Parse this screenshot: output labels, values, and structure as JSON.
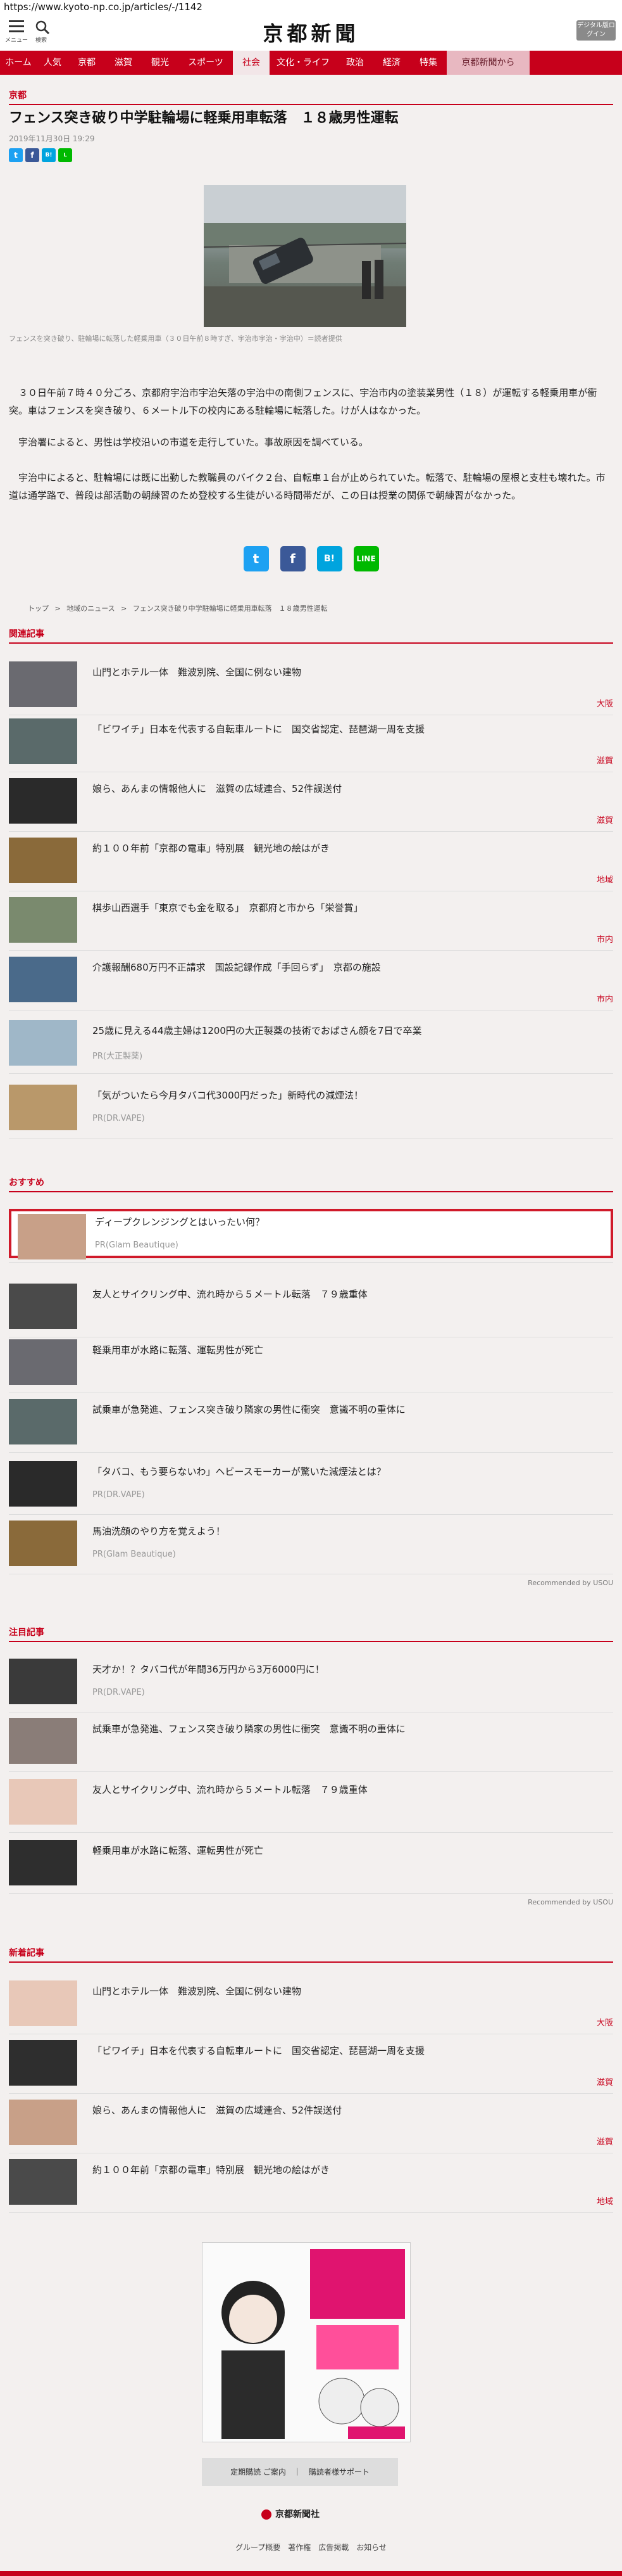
{
  "browser": {
    "url": "https://www.kyoto-np.co.jp/articles/-/1142"
  },
  "header": {
    "menu_label": "メニュー",
    "search_label": "検索",
    "logo": "京都新聞",
    "digital_label": "デジタル版ログイン"
  },
  "nav": [
    "ホーム",
    "人気",
    "京都",
    "滋賀",
    "観光",
    "スポーツ",
    "社会",
    "文化・ライフ",
    "政治",
    "経済",
    "特集",
    "京都新聞から"
  ],
  "article": {
    "section": "京都",
    "title": "フェンス突き破り中学駐輪場に軽乗用車転落　１８歳男性運転",
    "date": "2019年11月30日 19:29",
    "caption": "フェンスを突き破り、駐輪場に転落した軽乗用車（３０日午前８時すぎ、宇治市宇治・宇治中）＝読者提供",
    "paragraphs": [
      "３０日午前７時４０分ごろ、京都府宇治市宇治矢落の宇治中の南側フェンスに、宇治市内の塗装業男性（１８）が運転する軽乗用車が衝突。車はフェンスを突き破り、６メートル下の校内にある駐輪場に転落した。けが人はなかった。",
      "宇治署によると、男性は学校沿いの市道を走行していた。事故原因を調べている。",
      "宇治中によると、駐輪場には既に出勤した教職員のバイク２台、自転車１台が止められていた。転落で、駐輪場の屋根と支柱も壊れた。市道は通学路で、普段は部活動の朝練習のため登校する生徒がいる時間帯だが、この日は授業の関係で朝練習がなかった。"
    ],
    "breadcrumb": [
      "トップ",
      ">",
      "地域のニュース",
      ">",
      "フェンス突き破り中学駐輪場に軽乗用車転落　１８歳男性運転"
    ]
  },
  "related": {
    "heading": "関連記事",
    "items": [
      {
        "title": "山門とホテル一体　難波別院、全国に例ない建物",
        "cat": "大阪"
      },
      {
        "title": "「ビワイチ」日本を代表する自転車ルートに　国交省認定、琵琶湖一周を支援",
        "cat": "滋賀"
      },
      {
        "title": "娘ら、あんまの情報他人に　滋賀の広域連合、52件誤送付",
        "cat": "滋賀"
      },
      {
        "title": "約１００年前「京都の電車」特別展　観光地の絵はがき",
        "cat": "地域"
      },
      {
        "title": "棋歩山西選手「東京でも金を取る」　京都府と市から「栄誉賞」",
        "cat": "市内"
      },
      {
        "title": "介護報酬680万円不正請求　国設記録作成「手回らず」　京都の施設",
        "cat": "市内"
      },
      {
        "title": "25歳に見える44歳主婦は1200円の大正製薬の技術でおばさん顔を7日で卒業",
        "pr": "PR(大正製薬)"
      },
      {
        "title": "「気がついたら今月タバコ代3000円だった」新時代の減煙法！",
        "pr": "PR(DR.VAPE)"
      }
    ]
  },
  "recommend": {
    "heading": "おすすめ",
    "items": [
      {
        "title": "ディープクレンジングとはいったい何？",
        "pr": "PR(Glam Beautique)"
      },
      {
        "title": "友人とサイクリング中、流れ時から５メートル転落　７９歳重体"
      },
      {
        "title": "軽乗用車が水路に転落、運転男性が死亡"
      },
      {
        "title": "試乗車が急発進、フェンス突き破り隣家の男性に衝突　意識不明の重体に"
      },
      {
        "title": "「タバコ、もう要らないわ」ヘビースモーカーが驚いた減煙法とは？",
        "pr": "PR(DR.VAPE)"
      },
      {
        "title": "馬油洗顔のやり方を覚えよう！",
        "pr": "PR(Glam Beautique)"
      }
    ],
    "powered": "Recommended by USOU"
  },
  "popular": {
    "heading": "注目記事",
    "items": [
      {
        "title": "天才か！？タバコ代が年間36万円から3万6000円に！",
        "pr": "PR(DR.VAPE)"
      },
      {
        "title": "試乗車が急発進、フェンス突き破り隣家の男性に衝突　意識不明の重体に"
      },
      {
        "title": "友人とサイクリング中、流れ時から５メートル転落　７９歳重体"
      },
      {
        "title": "軽乗用車が水路に転落、運転男性が死亡"
      }
    ],
    "powered": "Recommended by USOU"
  },
  "latest": {
    "heading": "新着記事",
    "items": [
      {
        "title": "山門とホテル一体　難波別院、全国に例ない建物",
        "cat": "大阪"
      },
      {
        "title": "「ビワイチ」日本を代表する自転車ルートに　国交省認定、琵琶湖一周を支援",
        "cat": "滋賀"
      },
      {
        "title": "娘ら、あんまの情報他人に　滋賀の広域連合、52件誤送付",
        "cat": "滋賀"
      },
      {
        "title": "約１００年前「京都の電車」特別展　観光地の絵はがき",
        "cat": "地域"
      }
    ]
  },
  "footer": {
    "buttons": "定期購読 ご案内　｜　購読者様サポート",
    "company": "京都新聞社",
    "links": "グループ概要　著作権　広告掲載　お知らせ"
  },
  "colors": {
    "brand": "#c7001b",
    "twitter": "#1da1f2",
    "facebook": "#3b5998",
    "hatena": "#00a4de",
    "line": "#00b900"
  }
}
